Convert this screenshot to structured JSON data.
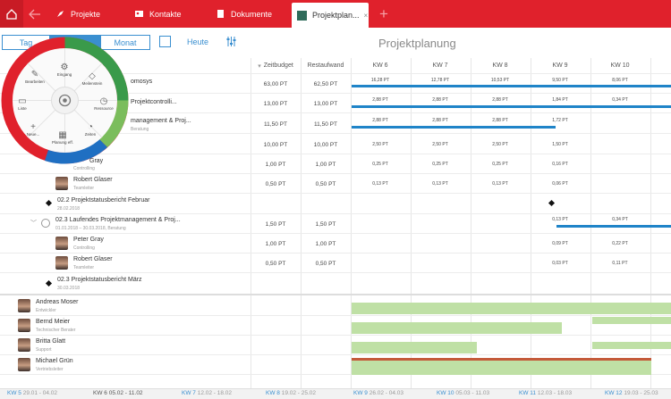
{
  "tabs": [
    {
      "label": "Projekte"
    },
    {
      "label": "Kontakte"
    },
    {
      "label": "Dokumente"
    },
    {
      "label": "Projektplan..."
    }
  ],
  "toolbar": {
    "seg_day": "Tag",
    "seg_month": "Monat",
    "today": "Heute"
  },
  "page_title": "Projektplanung",
  "columns": {
    "budget": "Zeitbudget",
    "effort": "Restaufwand",
    "weeks": [
      "KW 6",
      "KW 7",
      "KW 8",
      "KW 9",
      "KW 10"
    ]
  },
  "radial": {
    "items": [
      "Eingang",
      "Meilenstein",
      "Ressource",
      "Zeiten",
      "Planung eff.",
      "Neue...",
      "Liste",
      "Bearbeiten"
    ]
  },
  "rows": [
    {
      "name": "omosys",
      "sub": "",
      "budget": "63,00 PT",
      "effort": "62,50 PT",
      "weeks": [
        "16,28 PT",
        "12,78 PT",
        "10,53 PT",
        "9,50 PT",
        "8,06 PT"
      ]
    },
    {
      "name": "Projektcontrolli...",
      "sub": "",
      "budget": "13,00 PT",
      "effort": "13,00 PT",
      "weeks": [
        "2,88 PT",
        "2,88 PT",
        "2,88 PT",
        "1,84 PT",
        "0,34 PT"
      ]
    },
    {
      "name": "management & Proj...",
      "sub": "Beratung",
      "budget": "11,50 PT",
      "effort": "11,50 PT",
      "weeks": [
        "2,88 PT",
        "2,88 PT",
        "2,88 PT",
        "1,72 PT",
        ""
      ]
    },
    {
      "name": "",
      "sub": "",
      "budget": "10,00 PT",
      "effort": "10,00 PT",
      "weeks": [
        "2,50 PT",
        "2,50 PT",
        "2,50 PT",
        "1,50 PT",
        ""
      ]
    },
    {
      "name": "Gray",
      "sub": "Controlling",
      "budget": "1,00 PT",
      "effort": "1,00 PT",
      "weeks": [
        "0,25 PT",
        "0,25 PT",
        "0,25 PT",
        "0,16 PT",
        ""
      ]
    },
    {
      "name": "Robert Glaser",
      "sub": "Teamleiter",
      "budget": "0,50 PT",
      "effort": "0,50 PT",
      "weeks": [
        "0,13 PT",
        "0,13 PT",
        "0,13 PT",
        "0,06 PT",
        ""
      ]
    },
    {
      "name": "02.2 Projektstatusbericht Februar",
      "sub": "28.02.2018",
      "budget": "",
      "effort": "",
      "weeks": [
        "",
        "",
        "",
        "",
        ""
      ]
    },
    {
      "name": "02.3 Laufendes Projektmanagement & Proj...",
      "sub": "01.01.2018 – 30.03.2018, Beratung",
      "budget": "1,50 PT",
      "effort": "1,50 PT",
      "weeks": [
        "",
        "",
        "",
        "0,13 PT",
        "0,34 PT"
      ]
    },
    {
      "name": "Peter Gray",
      "sub": "Controlling",
      "budget": "1,00 PT",
      "effort": "1,00 PT",
      "weeks": [
        "",
        "",
        "",
        "0,09 PT",
        "0,22 PT"
      ]
    },
    {
      "name": "Robert Glaser",
      "sub": "Teamleiter",
      "budget": "0,50 PT",
      "effort": "0,50 PT",
      "weeks": [
        "",
        "",
        "",
        "0,03 PT",
        "0,11 PT"
      ]
    },
    {
      "name": "02.3 Projektstatusbericht März",
      "sub": "30.03.2018",
      "budget": "",
      "effort": "",
      "weeks": [
        "",
        "",
        "",
        "",
        ""
      ]
    }
  ],
  "resources": [
    {
      "name": "Andreas Moser",
      "role": "Entwickler"
    },
    {
      "name": "Bernd Meier",
      "role": "Technischer Berater"
    },
    {
      "name": "Britta Glatt",
      "role": "Support"
    },
    {
      "name": "Michael Grün",
      "role": "Vertriebsleiter"
    }
  ],
  "week_strip": [
    {
      "label": "KW 5",
      "range": "29.01 - 04.02"
    },
    {
      "label": "KW 6",
      "range": "05.02 - 11.02"
    },
    {
      "label": "KW 7",
      "range": "12.02 - 18.02"
    },
    {
      "label": "KW 8",
      "range": "19.02 - 25.02"
    },
    {
      "label": "KW 9",
      "range": "26.02 - 04.03"
    },
    {
      "label": "KW 10",
      "range": "05.03 - 11.03"
    },
    {
      "label": "KW 11",
      "range": "12.03 - 18.03"
    },
    {
      "label": "KW 12",
      "range": "19.03 - 25.03"
    }
  ],
  "colors": {
    "brand_red": "#e0212c",
    "accent_blue": "#3a8fd0",
    "bar_blue": "#1f84c8",
    "bar_green": "#bfe0a5"
  }
}
